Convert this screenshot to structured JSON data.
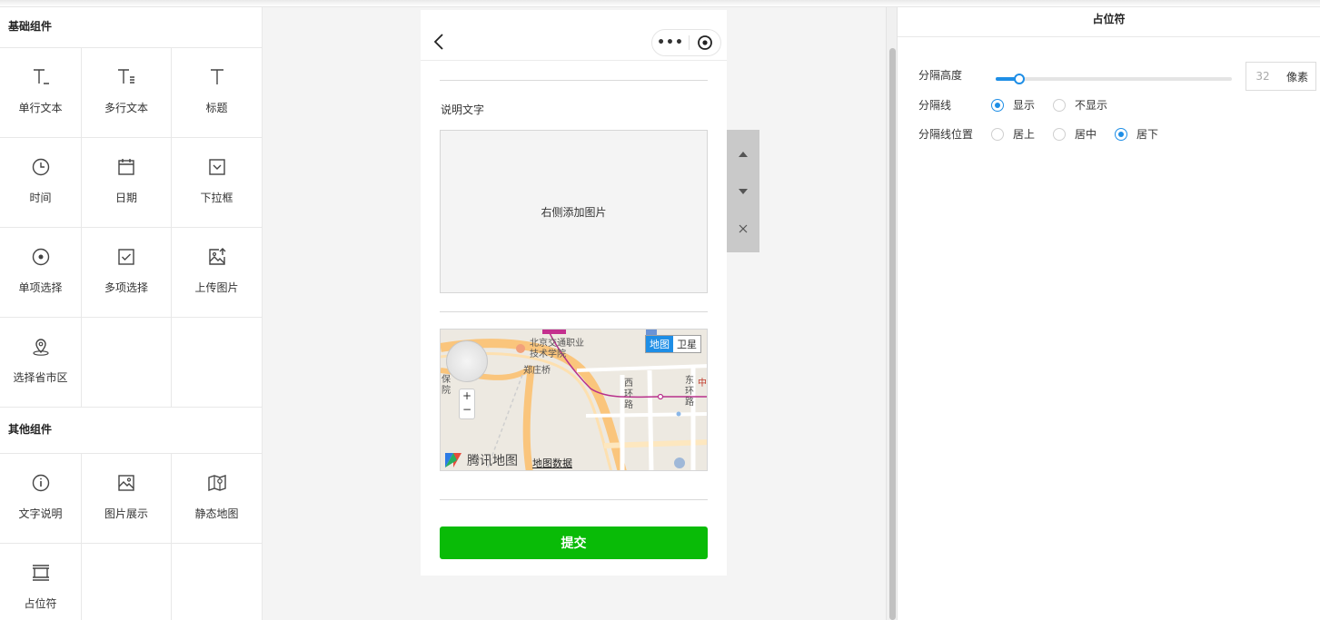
{
  "palette": {
    "basic_title": "基础组件",
    "basic_items": [
      {
        "label": "单行文本",
        "icon": "single-line-text-icon"
      },
      {
        "label": "多行文本",
        "icon": "multi-line-text-icon"
      },
      {
        "label": "标题",
        "icon": "title-icon"
      },
      {
        "label": "时间",
        "icon": "clock-icon"
      },
      {
        "label": "日期",
        "icon": "calendar-icon"
      },
      {
        "label": "下拉框",
        "icon": "dropdown-icon"
      },
      {
        "label": "单项选择",
        "icon": "radio-icon"
      },
      {
        "label": "多项选择",
        "icon": "checkbox-icon"
      },
      {
        "label": "上传图片",
        "icon": "image-upload-icon"
      },
      {
        "label": "选择省市区",
        "icon": "location-pin-icon"
      }
    ],
    "other_title": "其他组件",
    "other_items": [
      {
        "label": "文字说明",
        "icon": "info-icon"
      },
      {
        "label": "图片展示",
        "icon": "image-icon"
      },
      {
        "label": "静态地图",
        "icon": "map-icon"
      },
      {
        "label": "占位符",
        "icon": "spacer-icon"
      }
    ]
  },
  "phone": {
    "nav_more": "•••",
    "description_text": "说明文字",
    "image_placeholder": "右侧添加图片",
    "map": {
      "type_map": "地图",
      "type_satellite": "卫星",
      "brand": "腾讯地图",
      "data_link": "地图数据",
      "labels": {
        "poi1": "北京交通职业",
        "poi2": "技术学院",
        "place1": "郑庄桥",
        "road_west1": "西",
        "road_west2": "环",
        "road_west3": "路",
        "road_east1": "东",
        "road_east2": "环",
        "road_east3": "路",
        "edge1": "保",
        "edge2": "院",
        "edge3": "中"
      },
      "zoom_in": "+",
      "zoom_out": "−"
    },
    "submit_label": "提交"
  },
  "properties": {
    "title": "占位符",
    "spacing_label": "分隔高度",
    "spacing_value": "32",
    "spacing_unit": "像素",
    "spacing_fraction": 0.1,
    "divider_label": "分隔线",
    "divider_options": [
      "显示",
      "不显示"
    ],
    "divider_selected": 0,
    "divider_position_label": "分隔线位置",
    "position_options": [
      "居上",
      "居中",
      "居下"
    ],
    "position_selected": 2
  },
  "colors": {
    "accent": "#1e8ee6",
    "submit": "#09bb07"
  }
}
